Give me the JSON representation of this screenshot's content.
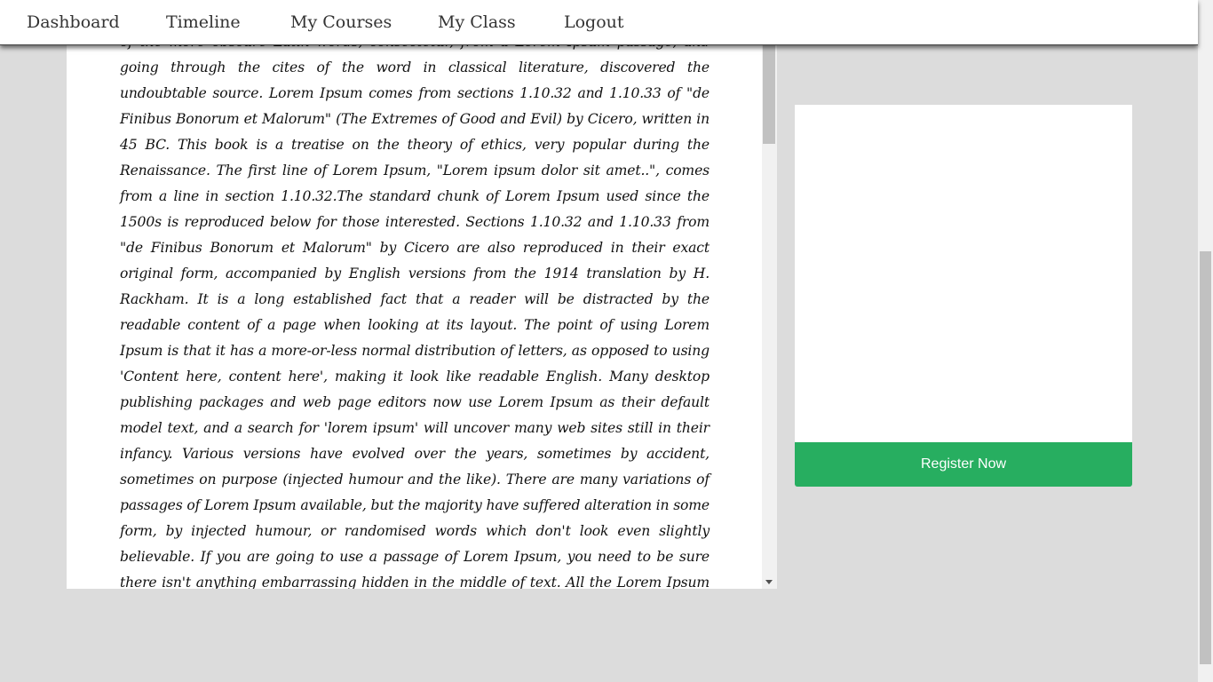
{
  "nav": {
    "items": [
      {
        "label": "Dashboard"
      },
      {
        "label": "Timeline"
      },
      {
        "label": "My Courses"
      },
      {
        "label": "My Class"
      },
      {
        "label": "Logout"
      }
    ]
  },
  "article": {
    "body": "of the more obscure Latin words, consectetur, from a Lorem Ipsum passage, and going through the cites of the word in classical literature, discovered the undoubtable source. Lorem Ipsum comes from sections 1.10.32 and 1.10.33 of \"de Finibus Bonorum et Malorum\" (The Extremes of Good and Evil) by Cicero, written in 45 BC. This book is a treatise on the theory of ethics, very popular during the Renaissance. The first line of Lorem Ipsum, \"Lorem ipsum dolor sit amet..\", comes from a line in section 1.10.32.The standard chunk of Lorem Ipsum used since the 1500s is reproduced below for those interested. Sections 1.10.32 and 1.10.33 from \"de Finibus Bonorum et Malorum\" by Cicero are also reproduced in their exact original form, accompanied by English versions from the 1914 translation by H. Rackham. It is a long established fact that a reader will be distracted by the readable content of a page when looking at its layout. The point of using Lorem Ipsum is that it has a more-or-less normal distribution of letters, as opposed to using 'Content here, content here', making it look like readable English. Many desktop publishing packages and web page editors now use Lorem Ipsum as their default model text, and a search for 'lorem ipsum' will uncover many web sites still in their infancy. Various versions have evolved over the years, sometimes by accident, sometimes on purpose (injected humour and the like). There are many variations of passages of Lorem Ipsum available, but the majority have suffered alteration in some form, by injected humour, or randomised words which don't look even slightly believable. If you are going to use a passage of Lorem Ipsum, you need to be sure there isn't anything embarrassing hidden in the middle of text. All the Lorem Ipsum generators on the Internet tend to repeat predefined chunks as necessary, making this"
  },
  "sidebar": {
    "register_label": "Register Now"
  },
  "colors": {
    "accent": "#27ae60",
    "background": "#dcdcdc"
  }
}
